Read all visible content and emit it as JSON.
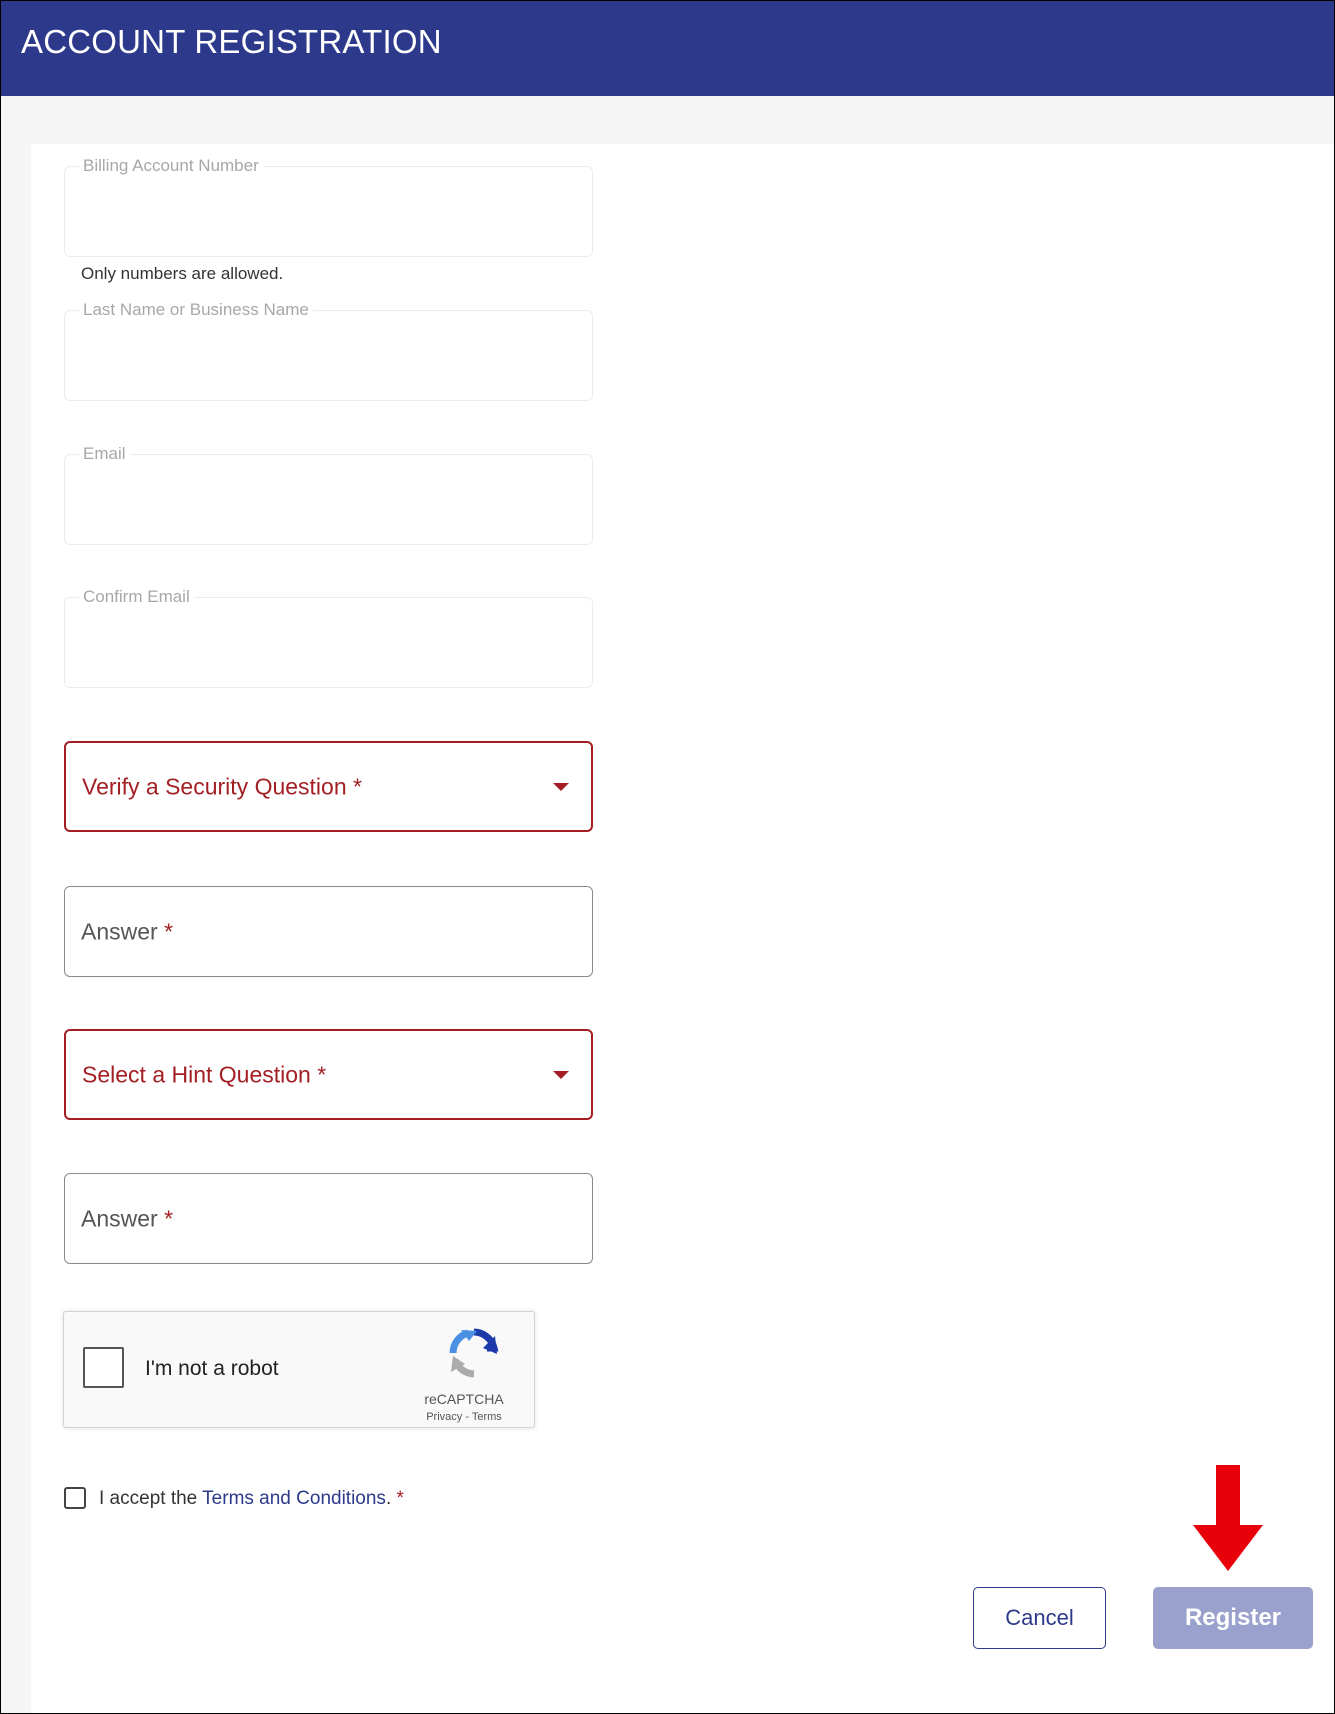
{
  "header": {
    "title": "ACCOUNT REGISTRATION",
    "background": "#2d3a8c"
  },
  "form": {
    "billing_account": {
      "label": "Billing Account Number",
      "helper": "Only numbers are allowed."
    },
    "last_name": {
      "label": "Last Name or Business Name"
    },
    "email": {
      "label": "Email"
    },
    "confirm_email": {
      "label": "Confirm Email"
    },
    "security_question": {
      "label": "Verify a Security Question",
      "required_mark": "*"
    },
    "security_answer": {
      "label": "Answer",
      "required_mark": "*"
    },
    "hint_question": {
      "label": "Select a Hint Question",
      "required_mark": "*"
    },
    "hint_answer": {
      "label": "Answer",
      "required_mark": "*"
    },
    "captcha": {
      "label": "I'm not a robot",
      "brand": "reCAPTCHA",
      "privacy": "Privacy",
      "separator": " - ",
      "terms": "Terms"
    },
    "terms": {
      "prefix": "I accept the ",
      "link": "Terms and Conditions",
      "suffix": ".",
      "required_mark": " *"
    },
    "buttons": {
      "cancel": "Cancel",
      "register": "Register"
    }
  },
  "colors": {
    "error": "#a31f24",
    "primary": "#2d3a8c",
    "register_disabled": "#9aa1cc",
    "annotation_arrow": "#e8000b"
  }
}
